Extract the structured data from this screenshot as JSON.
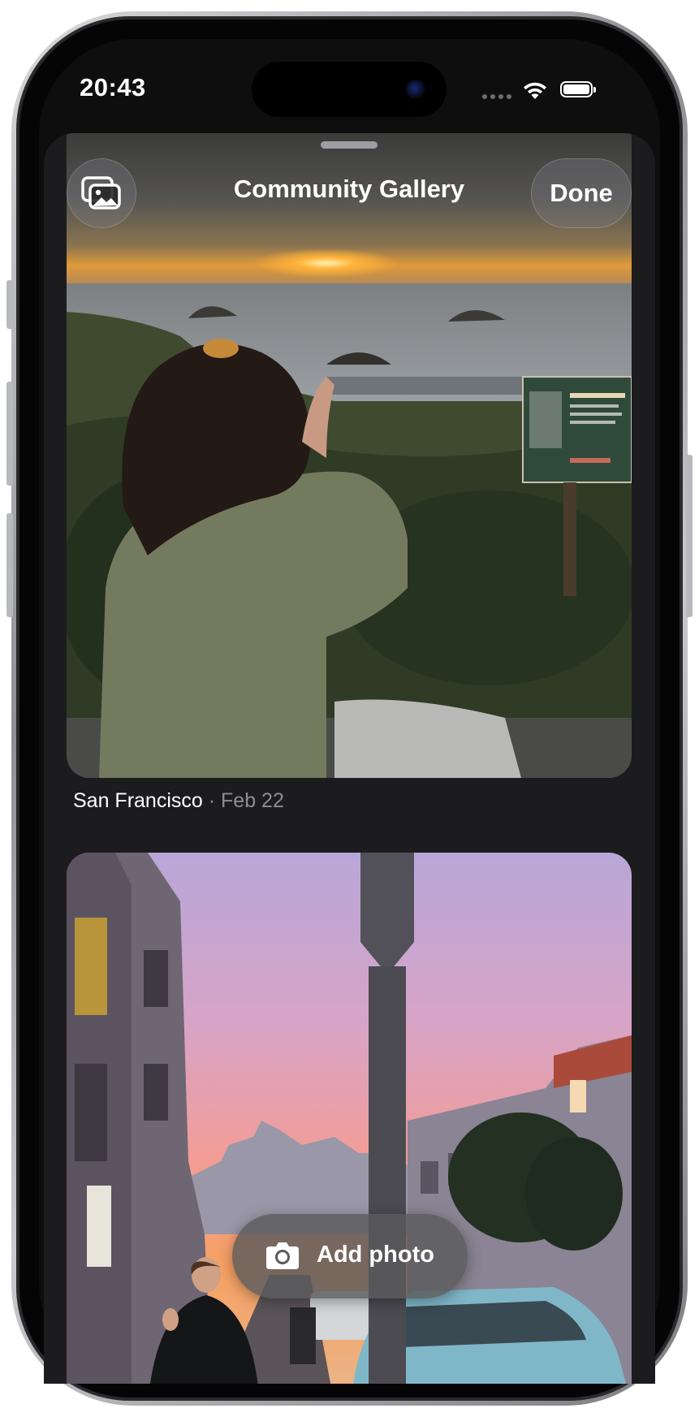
{
  "status_bar": {
    "time": "20:43"
  },
  "sheet": {
    "title": "Community Gallery",
    "done_label": "Done"
  },
  "posts": [
    {
      "location": "San Francisco",
      "separator": "·",
      "date": "Feb 22"
    }
  ],
  "add_photo": {
    "label": "Add photo"
  },
  "icons": {
    "gallery": "photo-stack-icon",
    "camera": "camera-icon",
    "wifi": "wifi-icon",
    "battery": "battery-icon"
  },
  "colors": {
    "sheet_background": "#1c1c1e",
    "secondary_text": "#8e8e93",
    "button_glass": "#78787e"
  }
}
